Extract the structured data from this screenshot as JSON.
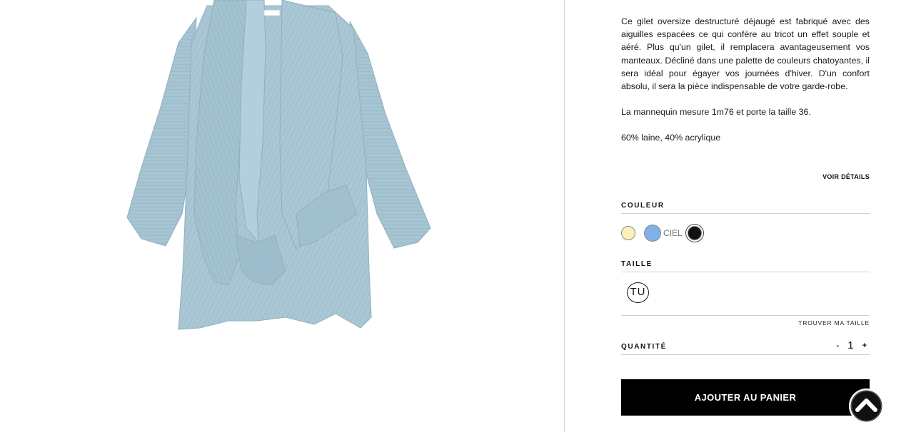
{
  "product": {
    "description": "Ce gilet oversize destructuré déjaugé est fabriqué avec des aiguilles espacées ce qui confère au tricot un effet souple et aéré. Plus qu'un gilet, il remplacera avantageusement vos manteaux. Décliné dans une palette de couleurs chatoyantes, il sera idéal pour égayer vos journées d'hiver. D'un confort absolu, il sera la pièce indispensable de votre garde-robe.",
    "model_info": "La mannequin mesure 1m76 et porte la taille 36.",
    "composition": "60% laine, 40% acrylique",
    "details_link": "VOIR DÉTAILS"
  },
  "color": {
    "label": "COULEUR",
    "selected_name": "CIEL",
    "swatches": [
      {
        "name": "jaune",
        "hex": "#fdf0b8"
      },
      {
        "name": "ciel",
        "hex": "#7fb1ea"
      },
      {
        "name": "noir",
        "hex": "#111111"
      }
    ]
  },
  "size": {
    "label": "TAILLE",
    "options": [
      "TU"
    ],
    "find_link": "TROUVER MA TAILLE"
  },
  "quantity": {
    "label": "QUANTITÉ",
    "minus": "-",
    "value": "1",
    "plus": "+"
  },
  "cart": {
    "button_label": "AJOUTER AU PANIER"
  },
  "scroll_top_icon": "chevron-up-icon",
  "colors": {
    "button_bg": "#000000",
    "garment": "#a9c7d4"
  }
}
